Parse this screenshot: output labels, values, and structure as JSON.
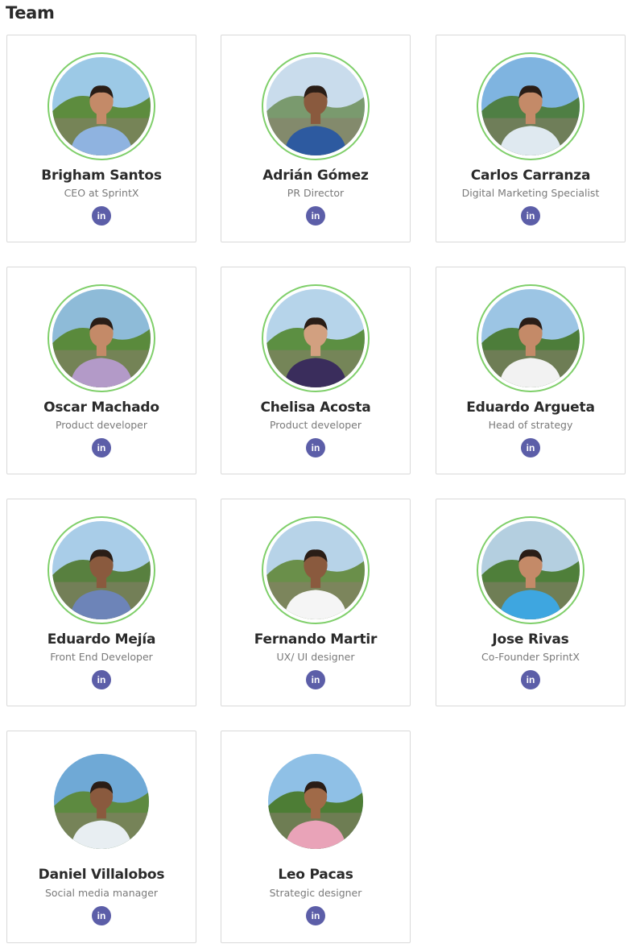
{
  "page": {
    "title": "Team"
  },
  "colors": {
    "ring": "#7fcf6a",
    "linkedin": "#5c5ea8",
    "border": "#d9d9d9"
  },
  "social_icon": "linkedin-icon",
  "social_icon_text": "in",
  "members": [
    {
      "name": "Brigham Santos",
      "role": "CEO at SprintX",
      "shirt": "#8fb3e0",
      "skin": "#c48a68",
      "sky": "#9cc9e6",
      "hill": "#5d8c3e"
    },
    {
      "name": "Adrián Gómez",
      "role": "PR Director",
      "shirt": "#2d5aa0",
      "skin": "#8a5a3e",
      "sky": "#c9dcec",
      "hill": "#7a9a6e"
    },
    {
      "name": "Carlos Carranza",
      "role": "Digital Marketing Specialist",
      "shirt": "#dfe9f0",
      "skin": "#c48a68",
      "sky": "#7fb4e0",
      "hill": "#4f7f44"
    },
    {
      "name": "Oscar Machado",
      "role": "Product developer",
      "shirt": "#b39ac8",
      "skin": "#c48a68",
      "sky": "#8ebbd8",
      "hill": "#5a8a3c"
    },
    {
      "name": "Chelisa Acosta",
      "role": "Product developer",
      "shirt": "#3a2d5c",
      "skin": "#d2a080",
      "sky": "#b6d4ea",
      "hill": "#5c8f42"
    },
    {
      "name": "Eduardo Argueta",
      "role": "Head of strategy",
      "shirt": "#f2f2f2",
      "skin": "#c48a68",
      "sky": "#9cc5e4",
      "hill": "#4d7d3a"
    },
    {
      "name": "Eduardo Mejía",
      "role": "Front End Developer",
      "shirt": "#6d84b8",
      "skin": "#8a5a3e",
      "sky": "#a9cde8",
      "hill": "#58803f"
    },
    {
      "name": "Fernando Martir",
      "role": "UX/ UI designer",
      "shirt": "#f5f5f5",
      "skin": "#8a5a3e",
      "sky": "#b7d3e8",
      "hill": "#6a8f4a"
    },
    {
      "name": "Jose Rivas",
      "role": "Co-Founder SprintX",
      "shirt": "#3ea6e0",
      "skin": "#c48a68",
      "sky": "#b4cfe0",
      "hill": "#4f7f3a"
    },
    {
      "name": "Daniel Villalobos",
      "role": "Social media manager",
      "shirt": "#e8eef2",
      "skin": "#8a5a3e",
      "sky": "#6fa9d6",
      "hill": "#5d8a40"
    },
    {
      "name": "Leo Pacas",
      "role": "Strategic designer",
      "shirt": "#e9a3b8",
      "skin": "#a06a48",
      "sky": "#8fc0e6",
      "hill": "#4d7d35"
    }
  ]
}
